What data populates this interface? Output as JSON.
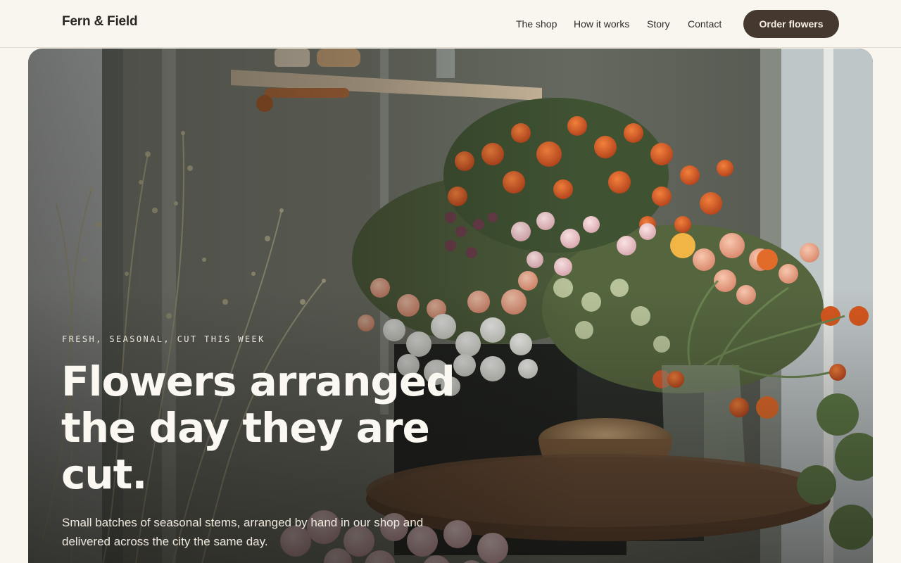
{
  "header": {
    "brand": "Fern & Field",
    "nav": [
      {
        "label": "The shop"
      },
      {
        "label": "How it works"
      },
      {
        "label": "Story"
      },
      {
        "label": "Contact"
      }
    ],
    "cta_label": "Order flowers"
  },
  "hero": {
    "eyebrow": "FRESH, SEASONAL, CUT THIS WEEK",
    "headline": "Flowers arranged the day they are cut.",
    "subline": "Small batches of seasonal stems, arranged by hand in our shop and delivered across the city the same day."
  },
  "colors": {
    "page_bg": "#f9f6f0",
    "cta_bg": "#45392f",
    "text_dark": "#2b2621"
  }
}
